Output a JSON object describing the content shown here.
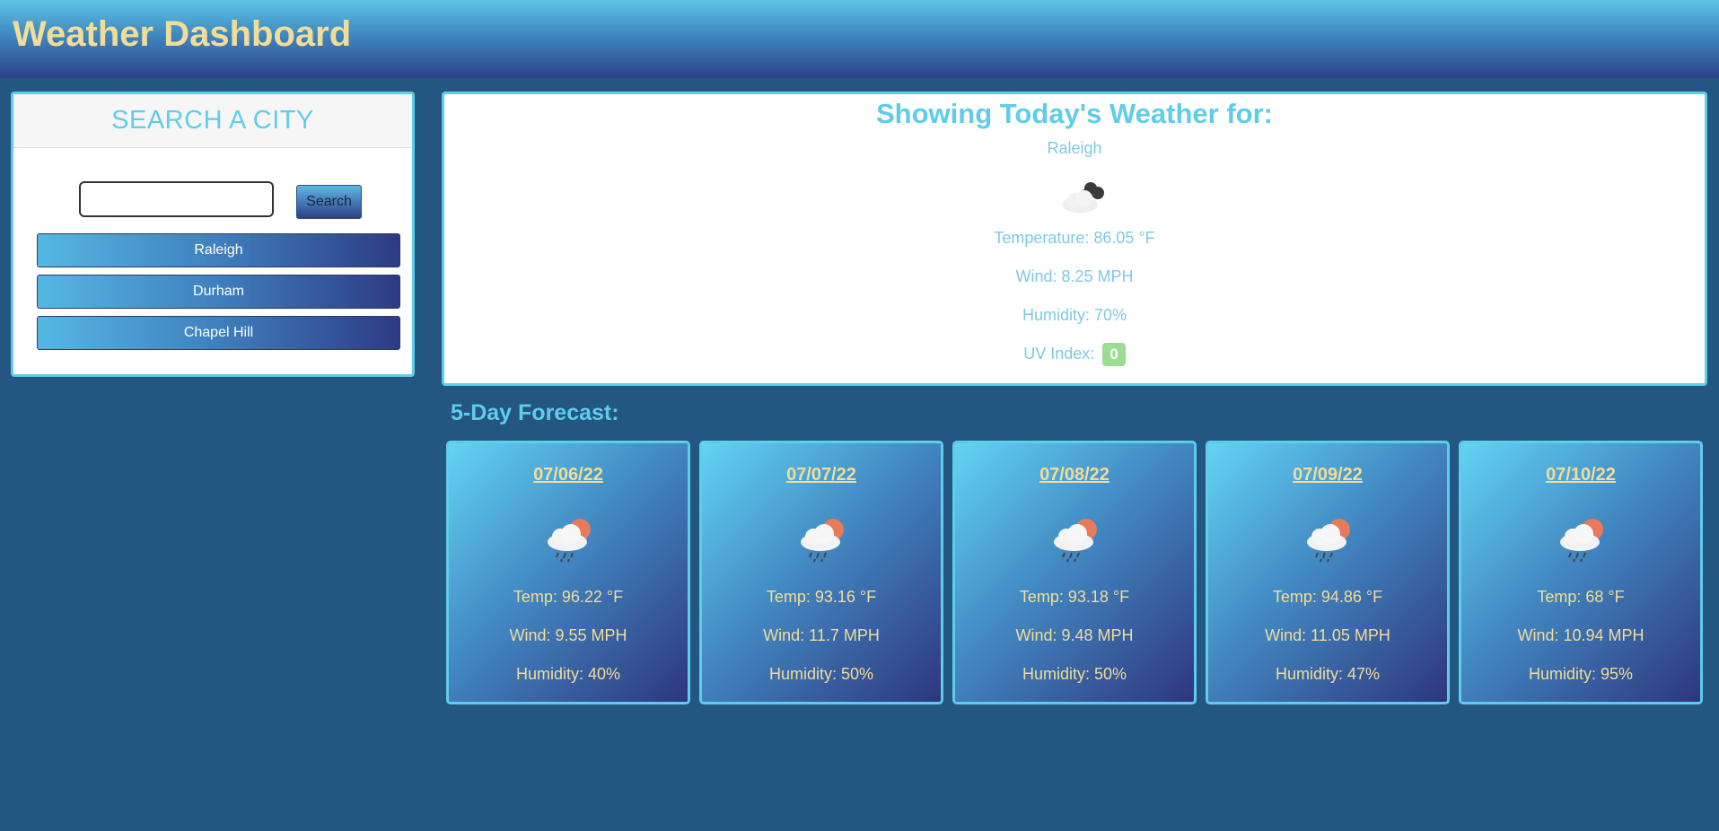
{
  "header": {
    "title": "Weather Dashboard"
  },
  "search": {
    "heading": "SEARCH A CITY",
    "input_value": "",
    "button_label": "Search",
    "history": [
      "Raleigh",
      "Durham",
      "Chapel Hill"
    ]
  },
  "today": {
    "heading": "Showing Today's Weather for:",
    "city": "Raleigh",
    "icon": "partly-cloudy-night-icon",
    "temperature": "Temperature: 86.05 °F",
    "wind": "Wind: 8.25 MPH",
    "humidity": "Humidity: 70%",
    "uv_label": "UV Index:",
    "uv_value": "0"
  },
  "forecast": {
    "title": "5-Day Forecast:",
    "days": [
      {
        "date": "07/06/22",
        "icon": "rain-sun-icon",
        "temp": "Temp: 96.22 °F",
        "wind": "Wind: 9.55 MPH",
        "humidity": "Humidity: 40%"
      },
      {
        "date": "07/07/22",
        "icon": "rain-sun-icon",
        "temp": "Temp: 93.16 °F",
        "wind": "Wind: 11.7 MPH",
        "humidity": "Humidity: 50%"
      },
      {
        "date": "07/08/22",
        "icon": "rain-sun-icon",
        "temp": "Temp: 93.18 °F",
        "wind": "Wind: 9.48 MPH",
        "humidity": "Humidity: 50%"
      },
      {
        "date": "07/09/22",
        "icon": "rain-sun-icon",
        "temp": "Temp: 94.86 °F",
        "wind": "Wind: 11.05 MPH",
        "humidity": "Humidity: 47%"
      },
      {
        "date": "07/10/22",
        "icon": "rain-sun-icon",
        "temp": "Temp: 68 °F",
        "wind": "Wind: 10.94 MPH",
        "humidity": "Humidity: 95%"
      }
    ]
  },
  "colors": {
    "background": "#235681",
    "accent": "#5fcdea",
    "title_gold": "#f3dc97",
    "uv_badge": "#9bdd93"
  }
}
